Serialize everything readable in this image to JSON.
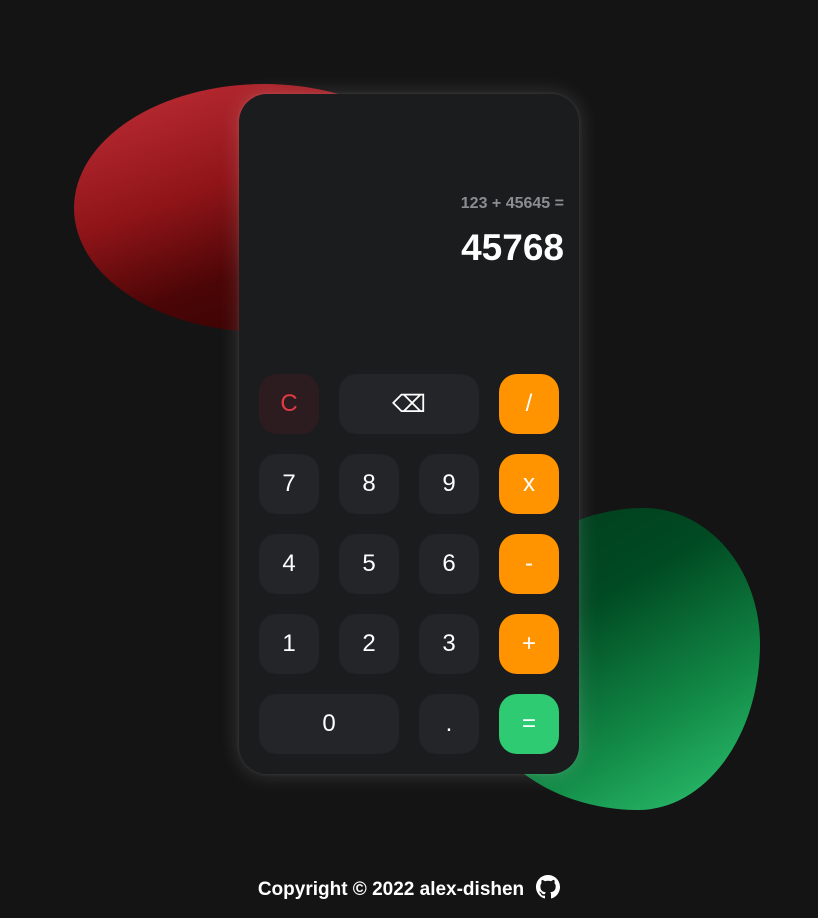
{
  "display": {
    "expression": "123 + 45645 =",
    "result": "45768"
  },
  "keypad": {
    "clear": "C",
    "backspace": "⌫",
    "divide": "/",
    "multiply": "x",
    "subtract": "-",
    "add": "+",
    "equals": "=",
    "decimal": ".",
    "d0": "0",
    "d1": "1",
    "d2": "2",
    "d3": "3",
    "d4": "4",
    "d5": "5",
    "d6": "6",
    "d7": "7",
    "d8": "8",
    "d9": "9"
  },
  "footer": {
    "copyright": "Copyright © 2022 alex-dishen",
    "icon": "github-icon"
  },
  "colors": {
    "background": "#141414",
    "panel": "#1b1c1e",
    "key": "#242528",
    "operator": "#ff9400",
    "equals": "#2ecb72",
    "clear": "#e03a44"
  }
}
